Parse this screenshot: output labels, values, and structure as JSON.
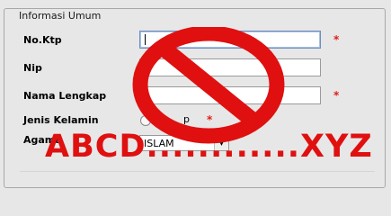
{
  "group": {
    "title": "Informasi Umum"
  },
  "form": {
    "no_ktp_label": "No.Ktp",
    "nip_label": "Nip",
    "nama_label": "Nama Lengkap",
    "jenis_label": "Jenis Kelamin",
    "agama_label": "Agama",
    "no_ktp_value": "",
    "nip_value": "",
    "nama_value": "",
    "radio_partial_label": "p",
    "agama_selected": "ISLAM",
    "required_mark": "*"
  },
  "overlay": {
    "text": "ABCD............XYZ",
    "symbol": "prohibition-sign",
    "color": "#e01010"
  }
}
